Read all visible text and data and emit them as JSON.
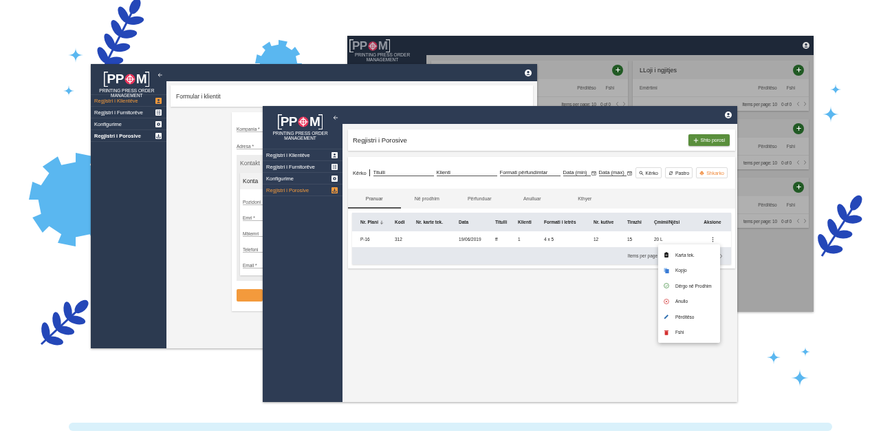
{
  "back_window": {
    "logo": {
      "before": "PP",
      "after": "M",
      "tagline": "PRINTING PRESS ORDER MANAGEMENT"
    },
    "left_cards": [
      {
        "action_columns": [
          "Përditëso",
          "Fshi"
        ],
        "footer": {
          "page_size": "Items per page: 10",
          "range": "0 of 0"
        }
      }
    ],
    "right_cards": [
      {
        "title": "LLoji i ngjitjes",
        "name_column": "Emërtimi",
        "action_columns": [
          "Përditëso",
          "Fshi"
        ],
        "footer": {
          "page_size": "Items per page: 10",
          "range": "0 of 0"
        }
      },
      {
        "action_columns": [
          "Përditëso",
          "Fshi"
        ],
        "footer": {
          "page_size": "tems per page: 10",
          "range": "0 of 0"
        }
      },
      {
        "action_columns": [
          "Përditëso",
          "Fshi"
        ],
        "footer": {
          "page_size": "tems per page: 10",
          "range": "0 of 0"
        }
      }
    ]
  },
  "client_window": {
    "logo": {
      "before": "PP",
      "after": "M",
      "tagline": "PRINTING PRESS ORDER MANAGEMENT"
    },
    "nav": [
      {
        "label": "Regjistri i Klientëve",
        "selected": true
      },
      {
        "label": "Regjistri i Furnitorëve",
        "selected": false
      },
      {
        "label": "Konfigurime",
        "selected": false
      },
      {
        "label": "Regjistri i Porosive",
        "selected": false
      }
    ],
    "form_title": "Formular i klientit",
    "fields": [
      {
        "placeholder": "Kompania *"
      },
      {
        "placeholder": "Adresa *"
      }
    ],
    "contacts": {
      "title": "Kontakt",
      "card_title": "Konta",
      "fields": [
        {
          "placeholder": "Pozicioni"
        },
        {
          "placeholder": "Emri *"
        },
        {
          "placeholder": "Mbiemri"
        },
        {
          "placeholder": "Telefoni"
        },
        {
          "placeholder": "Email *"
        }
      ]
    }
  },
  "orders_window": {
    "logo": {
      "before": "PP",
      "after": "M",
      "tagline": "PRINTING PRESS ORDER MANAGEMENT"
    },
    "nav": [
      {
        "label": "Regjistri i Klientëve",
        "selected": false
      },
      {
        "label": "Regjistri i Furnitorëve",
        "selected": false
      },
      {
        "label": "Konfigurime",
        "selected": false
      },
      {
        "label": "Regjistri i Porosive",
        "selected": true
      }
    ],
    "title": "Regjistri i Porosive",
    "add_button": "Shto porosi",
    "search_label": "Kërko",
    "filters": [
      {
        "placeholder": "Titulli",
        "kind": "text"
      },
      {
        "placeholder": "Klienti",
        "kind": "text"
      },
      {
        "placeholder": "Formati përfundimtar",
        "kind": "text"
      },
      {
        "placeholder": "Data (min)",
        "kind": "date"
      },
      {
        "placeholder": "Data (max)",
        "kind": "date"
      }
    ],
    "actions": [
      {
        "label": "Kërko",
        "kind": "search"
      },
      {
        "label": "Pastro",
        "kind": "clear"
      },
      {
        "label": "Shkarko",
        "kind": "download"
      }
    ],
    "tabs": [
      {
        "label": "Pranuar",
        "selected": true
      },
      {
        "label": "Në prodhim",
        "selected": false
      },
      {
        "label": "Përfunduar",
        "selected": false
      },
      {
        "label": "Anulluar",
        "selected": false
      },
      {
        "label": "Kthyer",
        "selected": false
      }
    ],
    "table": {
      "columns": [
        {
          "label": "Nr. Plani",
          "sorted": true
        },
        {
          "label": "Kodi",
          "sorted": false
        },
        {
          "label": "Nr. karte tek.",
          "sorted": false
        },
        {
          "label": "Data",
          "sorted": false
        },
        {
          "label": "Titulli",
          "sorted": false
        },
        {
          "label": "Klienti",
          "sorted": false
        },
        {
          "label": "Formati i letrës",
          "sorted": false
        },
        {
          "label": "Nr. kutive",
          "sorted": false
        },
        {
          "label": "Tirazhi",
          "sorted": false
        },
        {
          "label": "Çmimi/Njësi",
          "sorted": false
        },
        {
          "label": "Aksione",
          "sorted": false
        }
      ],
      "rows": [
        {
          "cells": [
            "P-16",
            "312",
            null,
            "19/06/2019",
            "ff",
            "1",
            "4 x 5",
            "12",
            "15",
            "20 L"
          ]
        }
      ],
      "footer": "Items per page"
    },
    "row_menu": [
      {
        "label": "Karta tek.",
        "kind": "clipboard"
      },
      {
        "label": "Kopjo",
        "kind": "copy"
      },
      {
        "label": "Dërgo në Prodhim",
        "kind": "approve"
      },
      {
        "label": "Anullo",
        "kind": "cancel"
      },
      {
        "label": "Përditëso",
        "kind": "edit"
      },
      {
        "label": "Fshi",
        "kind": "delete"
      }
    ]
  }
}
